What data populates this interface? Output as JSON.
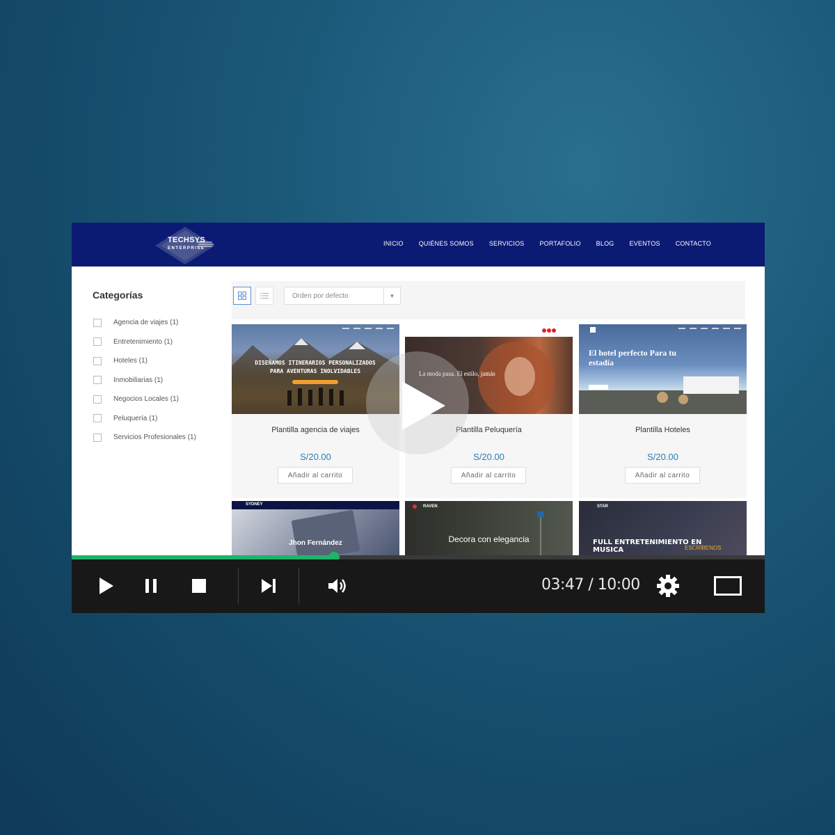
{
  "header": {
    "logo": {
      "title": "TECHSYS",
      "subtitle": "ENTERPRISE"
    },
    "nav": [
      "INICIO",
      "QUIÉNES SOMOS",
      "SERVICIOS",
      "PORTAFOLIO",
      "BLOG",
      "EVENTOS",
      "CONTACTO"
    ]
  },
  "sidebar": {
    "title": "Categorías",
    "categories": [
      "Agencia de viajes (1)",
      "Entretenimiento (1)",
      "Hoteles (1)",
      "Inmobiliarias (1)",
      "Negocios Locales (1)",
      "Peluquería (1)",
      "Servicios Profesionales (1)"
    ]
  },
  "toolbar": {
    "sort_label": "Orden por defecto",
    "grid_icon": "grid-icon",
    "list_icon": "list-icon"
  },
  "products": [
    {
      "name": "Plantilla agencia de viajes",
      "price": "S/20.00",
      "button": "Añadir al carrito",
      "thumb_text": "DISEÑAMOS ITINERARIOS PERSONALIZADOS PARA AVENTURAS INOLVIDABLES"
    },
    {
      "name": "Plantilla Peluquería",
      "price": "S/20.00",
      "button": "Añadir al carrito",
      "thumb_text": "La moda pasa. El estilo, jamás"
    },
    {
      "name": "Plantilla Hoteles",
      "price": "S/20.00",
      "button": "Añadir al carrito",
      "thumb_text": "El hotel perfecto Para tu estadía"
    }
  ],
  "products_row2": [
    {
      "brand": "SYDNEY",
      "thumb_text": "Jhon Fernández"
    },
    {
      "brand": "RAVEN",
      "thumb_text": "Decora con elegancia"
    },
    {
      "brand": "STAR",
      "thumb_text": "FULL ENTRETENIMIENTO EN MUSICA",
      "thumb_text2": "ESCRÍBENOS"
    }
  ],
  "player": {
    "time": "03:47 / 10:00",
    "progress_fraction": 0.379,
    "accent": "#1fb36a"
  }
}
